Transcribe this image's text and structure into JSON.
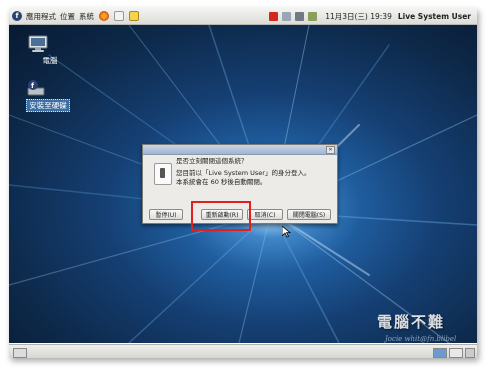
{
  "top_panel": {
    "menus": [
      "應用程式",
      "位置",
      "系統"
    ],
    "clock": "11月3日(三) 19:39",
    "user": "Live System User"
  },
  "desktop": {
    "icons": [
      {
        "label": "電腦"
      },
      {
        "label": "安裝至硬碟"
      }
    ],
    "watermark": "電腦不難",
    "watermark_sub": "Jocie whit@fn.blibel"
  },
  "dialog": {
    "question": "是否立刻關閉這個系統？",
    "message_line1": "您目前以「Live System User」的身分登入。",
    "message_line2": "本系統會在 60 秒後自動關閉。",
    "buttons": {
      "suspend": "暫停(U)",
      "restart": "重新啟動(R)",
      "cancel": "取消(C)",
      "shutdown": "關閉電腦(S)"
    }
  },
  "colors": {
    "highlight": "#e02020",
    "desktop_accent": "#3f86c8"
  }
}
